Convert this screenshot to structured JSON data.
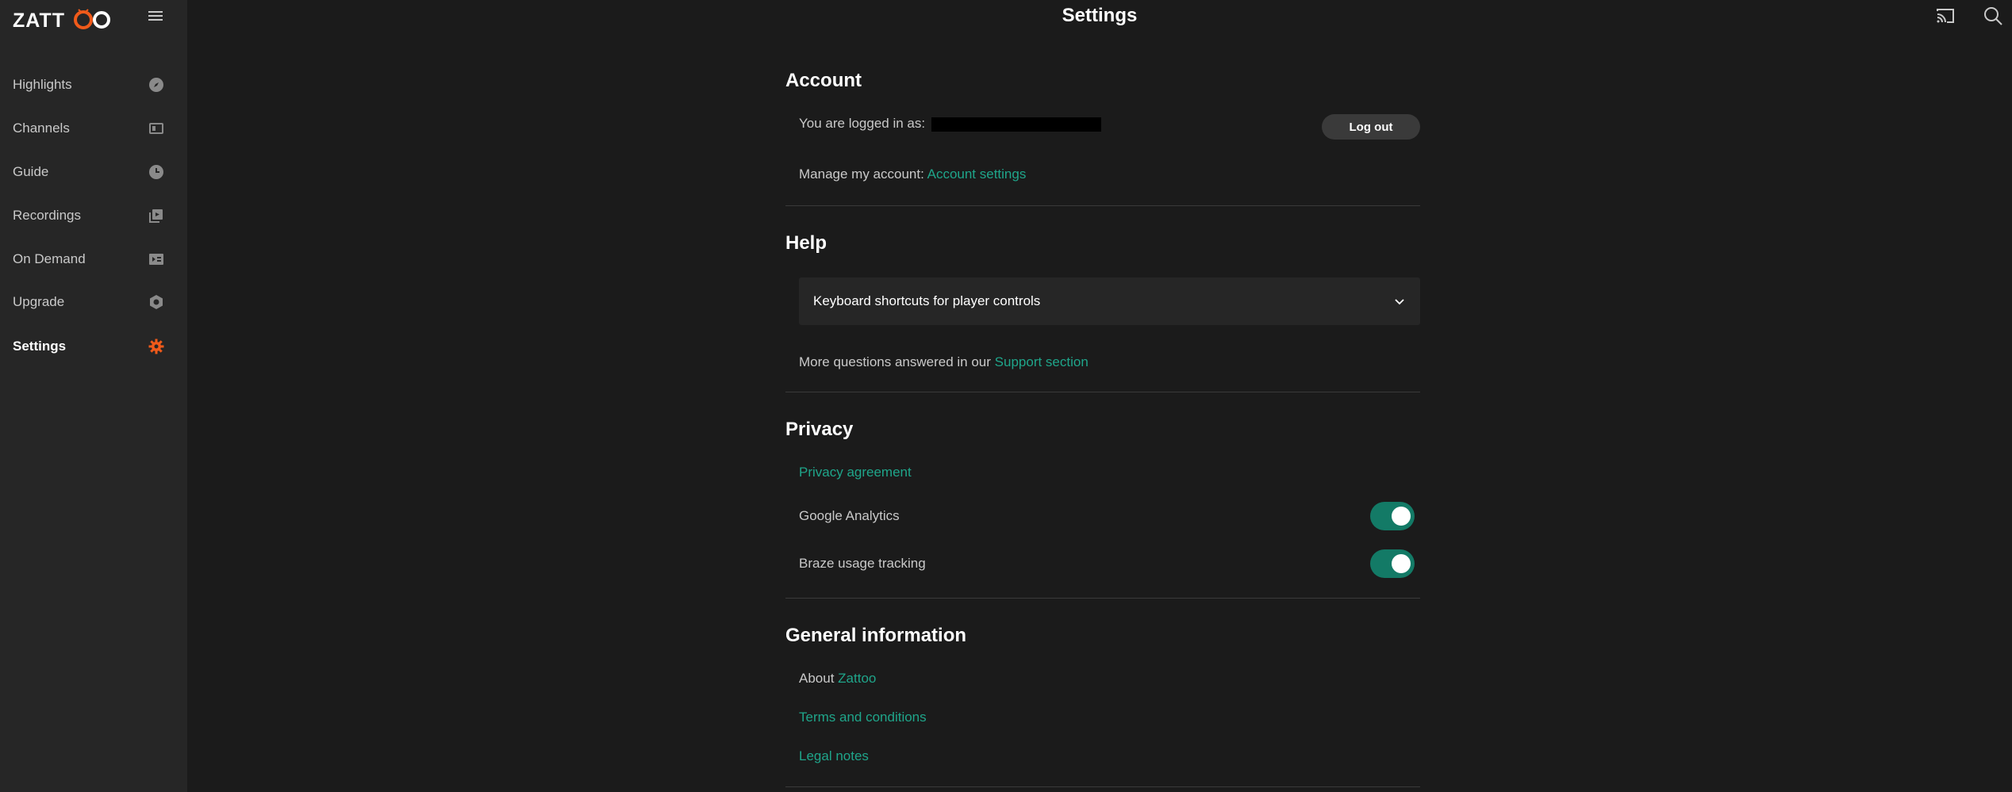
{
  "brand": {
    "logo_text": "ZATTOO",
    "accent": "#f05a1a"
  },
  "header": {
    "title": "Settings",
    "cast_icon": "cast-icon",
    "search_icon": "search-icon"
  },
  "sidebar": {
    "items": [
      {
        "label": "Highlights",
        "icon": "compass-icon"
      },
      {
        "label": "Channels",
        "icon": "channels-icon"
      },
      {
        "label": "Guide",
        "icon": "clock-icon"
      },
      {
        "label": "Recordings",
        "icon": "recordings-icon"
      },
      {
        "label": "On Demand",
        "icon": "on-demand-icon"
      },
      {
        "label": "Upgrade",
        "icon": "upgrade-icon"
      },
      {
        "label": "Settings",
        "icon": "gear-icon",
        "active": true
      }
    ]
  },
  "account": {
    "title": "Account",
    "logged_in_label": "You are logged in as:",
    "logout_label": "Log out",
    "manage_label": "Manage my account:",
    "manage_link": "Account settings"
  },
  "help": {
    "title": "Help",
    "accordion_label": "Keyboard shortcuts for player controls",
    "more_label": "More questions answered in our",
    "support_link": "Support section"
  },
  "privacy": {
    "title": "Privacy",
    "agreement_link": "Privacy agreement",
    "google_label": "Google Analytics",
    "google_on": true,
    "braze_label": "Braze usage tracking",
    "braze_on": true
  },
  "general": {
    "title": "General information",
    "about_label": "About",
    "about_link": "Zattoo",
    "terms_link": "Terms and conditions",
    "legal_link": "Legal notes"
  },
  "colors": {
    "link": "#1fa58a",
    "toggle": "#137a66",
    "sidebar_bg": "#262626",
    "page_bg": "#1b1b1b"
  }
}
